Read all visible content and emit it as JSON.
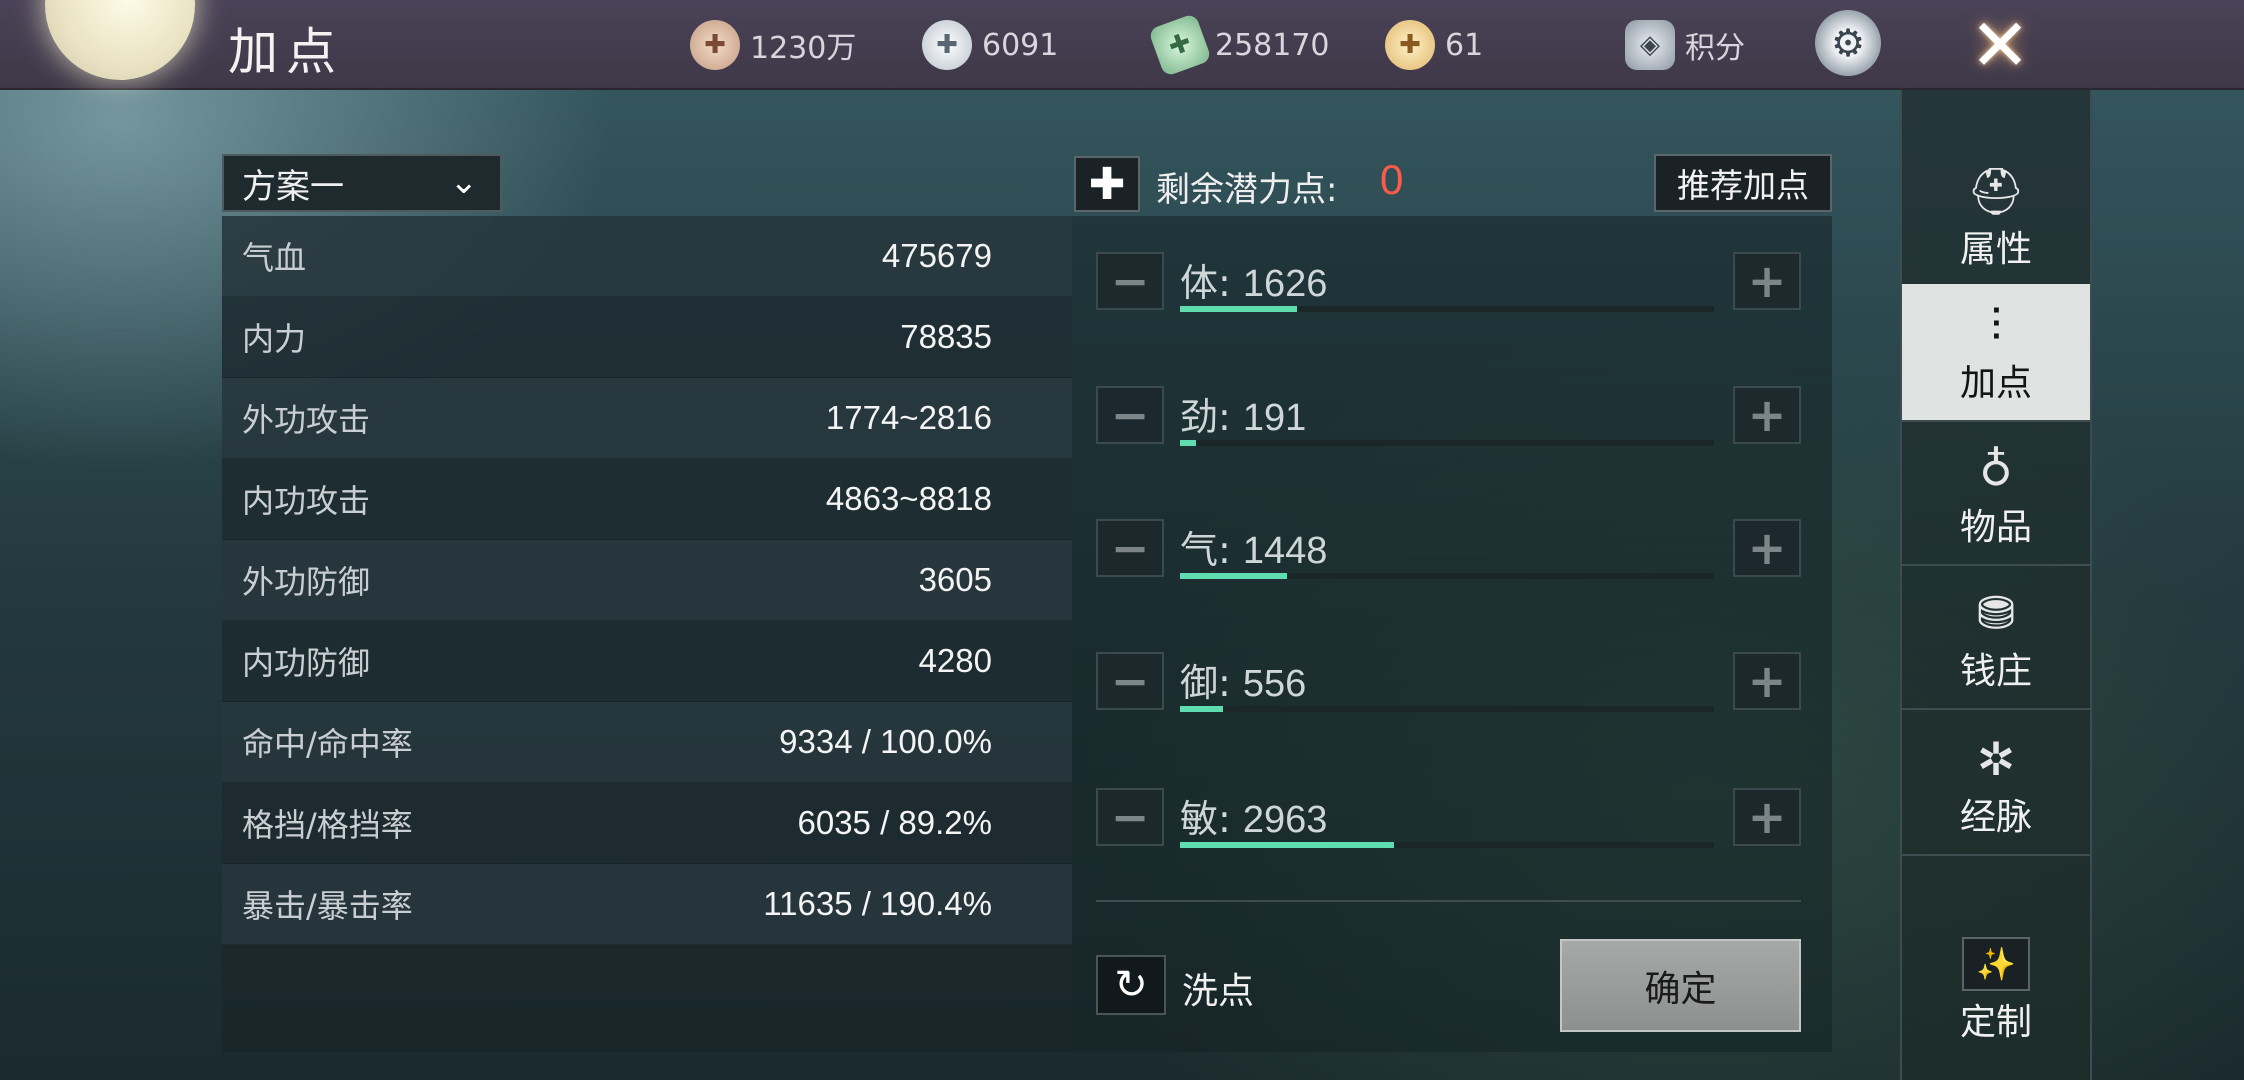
{
  "header": {
    "title": "加点",
    "currencies": [
      {
        "icon": "coin-add-icon",
        "value": "1230万"
      },
      {
        "icon": "silver-ingot-add-icon",
        "value": "6091"
      },
      {
        "icon": "jade-add-icon",
        "value": "258170"
      },
      {
        "icon": "gold-ingot-add-icon",
        "value": "61"
      }
    ],
    "score_label": "积分",
    "icons": {
      "settings": "gear-icon",
      "close": "close-icon"
    }
  },
  "plan": {
    "selected": "方案一",
    "chevron": "⌄"
  },
  "stats": [
    {
      "label": "气血",
      "value": "475679"
    },
    {
      "label": "内力",
      "value": "78835"
    },
    {
      "label": "外功攻击",
      "value": "1774~2816"
    },
    {
      "label": "内功攻击",
      "value": "4863~8818"
    },
    {
      "label": "外功防御",
      "value": "3605"
    },
    {
      "label": "内功防御",
      "value": "4280"
    },
    {
      "label": "命中/命中率",
      "value": "9334 / 100.0%"
    },
    {
      "label": "格挡/格挡率",
      "value": "6035 / 89.2%"
    },
    {
      "label": "暴击/暴击率",
      "value": "11635 / 190.4%"
    }
  ],
  "allocation": {
    "remaining_label": "剩余潜力点:",
    "remaining_value": "0",
    "recommend_label": "推荐加点",
    "attributes": [
      {
        "name": "体",
        "value": "1626",
        "fill": 0.22
      },
      {
        "name": "劲",
        "value": "191",
        "fill": 0.03
      },
      {
        "name": "气",
        "value": "1448",
        "fill": 0.2
      },
      {
        "name": "御",
        "value": "556",
        "fill": 0.08
      },
      {
        "name": "敏",
        "value": "2963",
        "fill": 0.4
      }
    ],
    "attr_separator": ": ",
    "reset_label": "洗点",
    "confirm_label": "确定"
  },
  "sidebar": {
    "items": [
      {
        "label": "属性",
        "icon": "hat-icon",
        "active": false
      },
      {
        "label": "加点",
        "icon": "sliders-icon",
        "active": true
      },
      {
        "label": "物品",
        "icon": "bag-icon",
        "active": false
      },
      {
        "label": "钱庄",
        "icon": "money-bag-icon",
        "active": false
      },
      {
        "label": "经脉",
        "icon": "meridian-icon",
        "active": false
      },
      {
        "label": "定制",
        "icon": "magic-wand-icon",
        "active": false
      }
    ]
  },
  "colors": {
    "accent_fill": "#5fdcb0",
    "remaining_points": "#ff5a4a",
    "active_tab_bg": "#dfe3e2"
  }
}
